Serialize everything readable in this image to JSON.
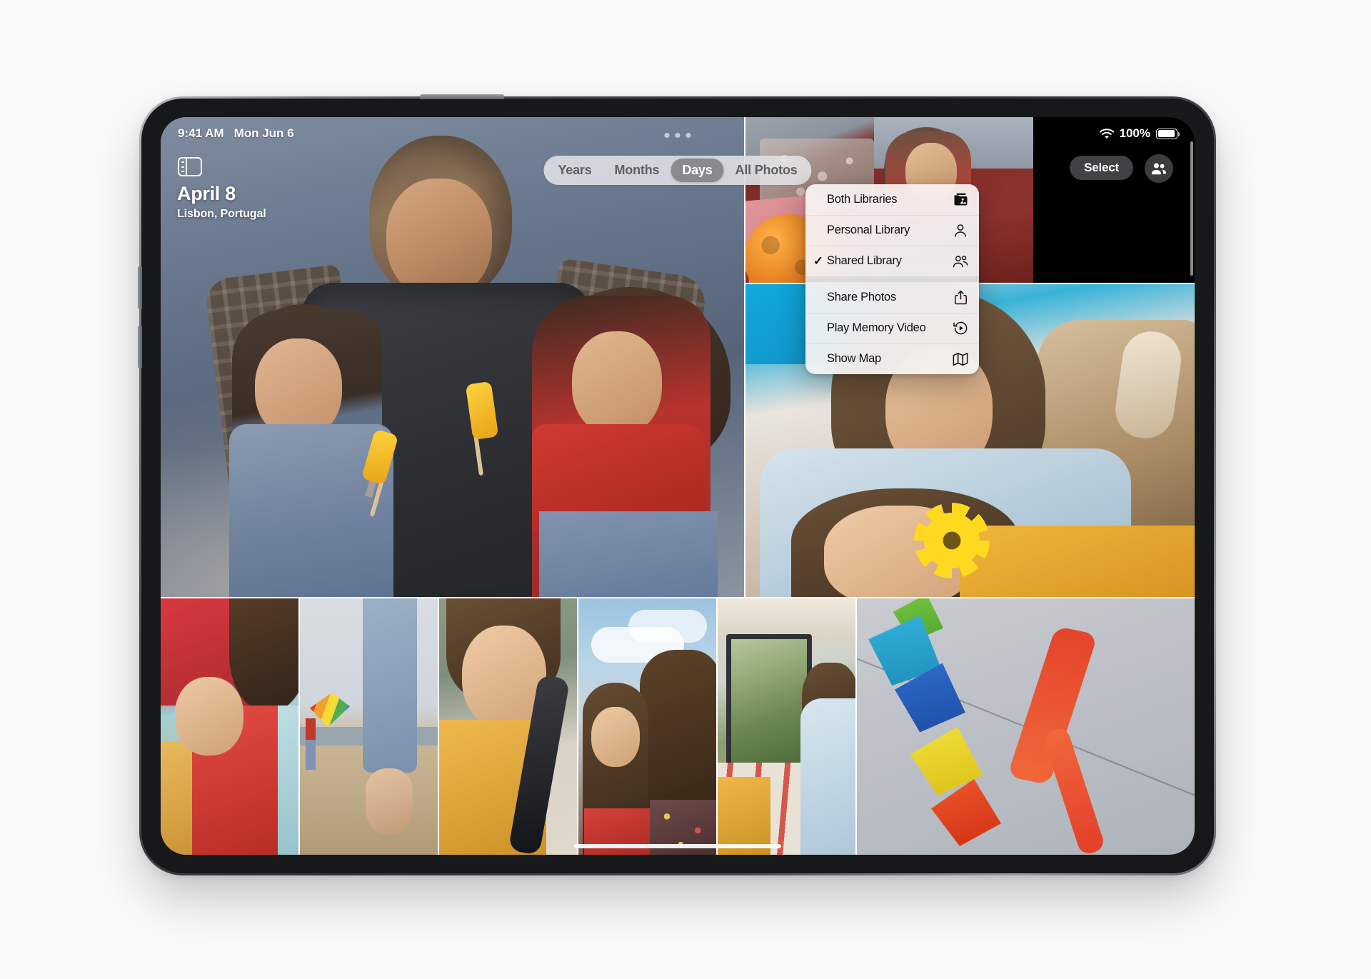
{
  "status_bar": {
    "time": "9:41 AM",
    "date": "Mon Jun 6",
    "wifi_icon": "wifi-icon",
    "battery_percent": "100%",
    "battery_icon": "battery-full-icon"
  },
  "toolbar": {
    "sidebar_toggle_icon": "sidebar-toggle-icon",
    "multitask_handle_icon": "multitask-dots-icon",
    "select_label": "Select",
    "shared_library_icon": "people-two-icon"
  },
  "day_header": {
    "title": "April 8",
    "subtitle": "Lisbon, Portugal"
  },
  "segmented_control": {
    "options": [
      {
        "label": "Years",
        "selected": false
      },
      {
        "label": "Months",
        "selected": false
      },
      {
        "label": "Days",
        "selected": true
      },
      {
        "label": "All Photos",
        "selected": false
      }
    ]
  },
  "context_menu": {
    "groups": [
      {
        "items": [
          {
            "label": "Both Libraries",
            "icon": "photo-stack-icon",
            "checked": false
          },
          {
            "label": "Personal Library",
            "icon": "person-icon",
            "checked": false
          },
          {
            "label": "Shared Library",
            "icon": "people-two-icon",
            "checked": true
          }
        ]
      },
      {
        "items": [
          {
            "label": "Share Photos",
            "icon": "share-up-icon",
            "checked": false
          },
          {
            "label": "Play Memory Video",
            "icon": "play-history-icon",
            "checked": false
          },
          {
            "label": "Show Map",
            "icon": "map-icon",
            "checked": false
          }
        ]
      }
    ]
  },
  "photo_grid": {
    "photos": [
      {
        "name": "photo-hero",
        "description": "Father carrying two girls holding popsicles"
      },
      {
        "name": "photo-van",
        "description": "Girl leaning out of red camper van with orange ball"
      },
      {
        "name": "photo-flower",
        "description": "Two girls with a yellow flower and a dog in a car"
      },
      {
        "name": "photo-b1",
        "description": "Two girls reclining against a red wall"
      },
      {
        "name": "photo-b2",
        "description": "Bare feet on beach sand with a kite flyer"
      },
      {
        "name": "photo-b3",
        "description": "Girl in yellow jacket resting on a car window"
      },
      {
        "name": "photo-b4",
        "description": "Two girls with windblown hair against a cloudy sky"
      },
      {
        "name": "photo-b5",
        "description": "Girl in blue sweater inside a camper van"
      },
      {
        "name": "photo-b6",
        "description": "Colorful kites against a grey wall"
      }
    ]
  },
  "device": {
    "buttons": [
      "volume-up-button",
      "volume-down-button",
      "power-button"
    ],
    "home_indicator": "home-indicator"
  },
  "colors": {
    "accent_selected_segment": "#878a8e",
    "menu_background": "#f7f4f4",
    "page_background": "#fafafa"
  }
}
